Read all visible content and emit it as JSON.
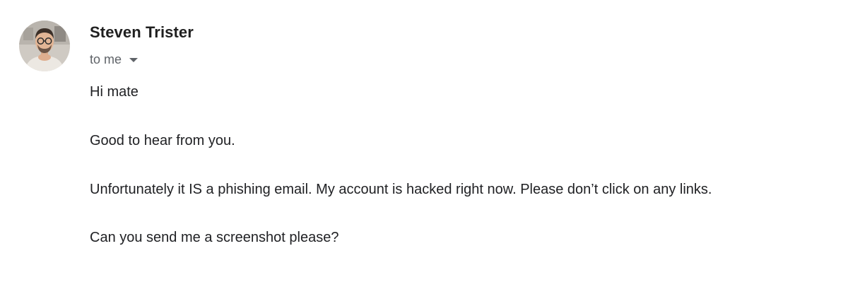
{
  "sender": {
    "name": "Steven Trister",
    "avatar_icon": "profile-photo-avatar"
  },
  "recipient": {
    "label": "to me",
    "toggle_icon": "caret-down-icon"
  },
  "body": {
    "lines": [
      "Hi mate",
      "Good to hear from you.",
      "Unfortunately it IS a phishing email. My account is hacked right now. Please don’t click on any links.",
      "Can you send me a screenshot please?"
    ]
  },
  "colors": {
    "text_primary": "#202124",
    "text_secondary": "#5f6368",
    "background": "#ffffff"
  }
}
